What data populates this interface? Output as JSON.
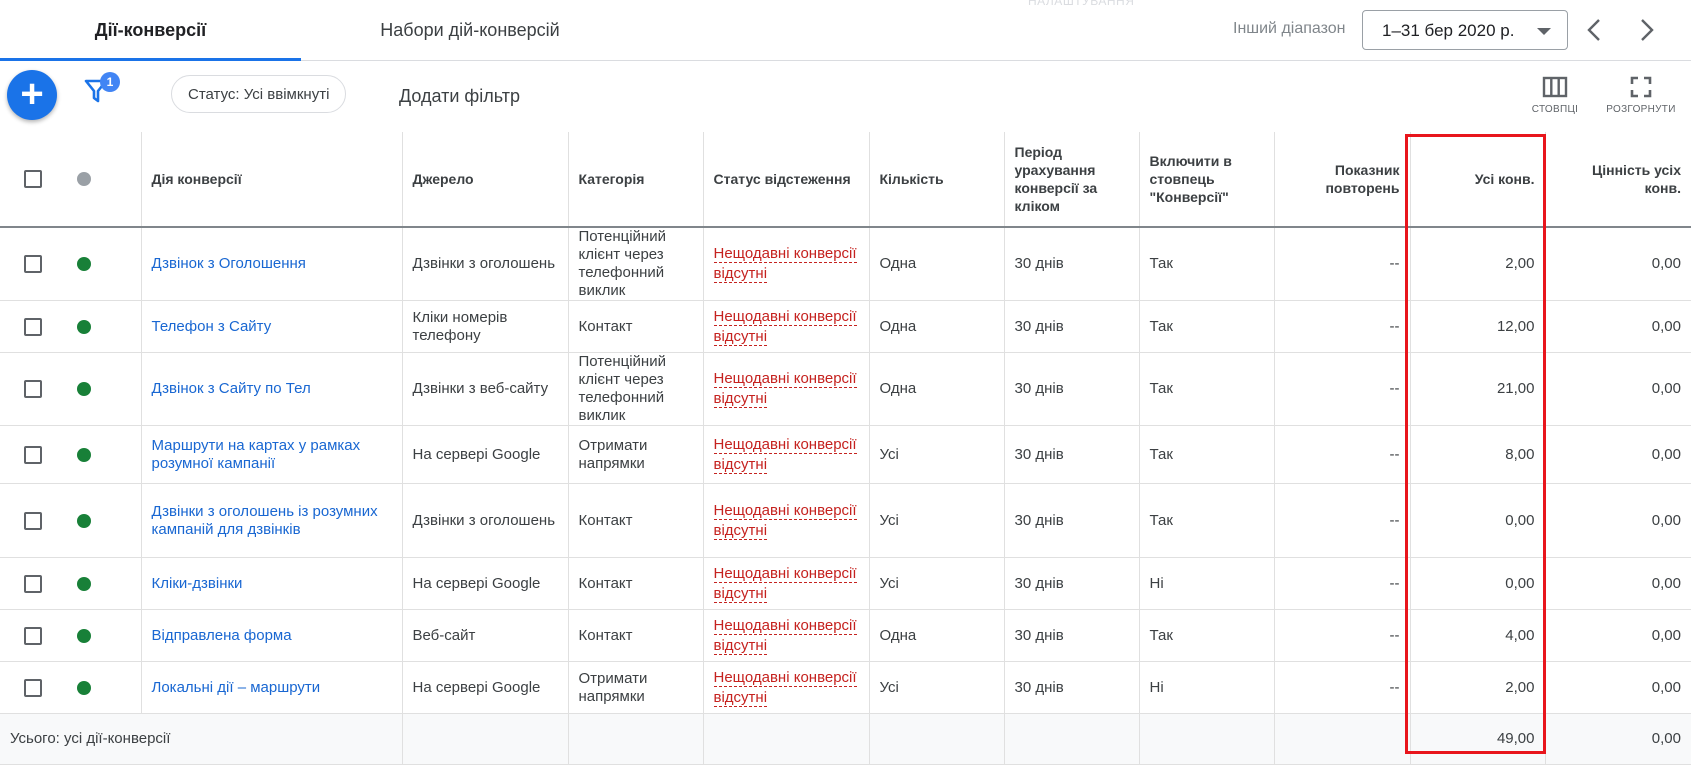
{
  "ghost_text": "НАЛАШТУВАННЯ",
  "tabs": [
    {
      "label": "Дії-конверсії",
      "active": true
    },
    {
      "label": "Набори дій-конверсій",
      "active": false
    }
  ],
  "date_range": {
    "label": "Інший діапазон",
    "value": "1–31 бер 2020 р."
  },
  "toolbar": {
    "filter_badge": "1",
    "status_chip": "Статус: Усі ввімкнуті",
    "add_filter": "Додати фільтр",
    "columns_label": "СТОВПЦІ",
    "expand_label": "РОЗГОРНУТИ"
  },
  "colors": {
    "accent": "#1a73e8",
    "link": "#1967d2",
    "status_red": "#c5221f",
    "enabled_green": "#188038",
    "highlight": "#e8151c"
  },
  "table": {
    "headers": {
      "action": "Дія конверсії",
      "source": "Джерело",
      "category": "Категорія",
      "tracking": "Статус відстеження",
      "count": "Кількість",
      "window": "Період урахування конверсії за кліком",
      "include": "Включити в стовпець \"Конверсії\"",
      "repeat": "Показник повторень",
      "all_conv": "Усі конв.",
      "all_value": "Цінність усіх конв."
    },
    "rows": [
      {
        "action": "Дзвінок з Оголошення",
        "source": "Дзвінки з оголошень",
        "category": "Потенційний клієнт через телефонний виклик",
        "tracking": "Нещодавні конверсії відсутні",
        "count": "Одна",
        "window": "30 днів",
        "include": "Так",
        "repeat": "--",
        "all_conv": "2,00",
        "all_value": "0,00"
      },
      {
        "action": "Телефон з Сайту",
        "source": "Кліки номерів телефону",
        "category": "Контакт",
        "tracking": "Нещодавні конверсії відсутні",
        "count": "Одна",
        "window": "30 днів",
        "include": "Так",
        "repeat": "--",
        "all_conv": "12,00",
        "all_value": "0,00"
      },
      {
        "action": "Дзвінок з Сайту по Тел",
        "source": "Дзвінки з веб-сайту",
        "category": "Потенційний клієнт через телефонний виклик",
        "tracking": "Нещодавні конверсії відсутні",
        "count": "Одна",
        "window": "30 днів",
        "include": "Так",
        "repeat": "--",
        "all_conv": "21,00",
        "all_value": "0,00"
      },
      {
        "action": "Маршрути на картах у рамках розумної кампанії",
        "source": "На сервері Google",
        "category": "Отримати напрямки",
        "tracking": "Нещодавні конверсії відсутні",
        "count": "Усі",
        "window": "30 днів",
        "include": "Так",
        "repeat": "--",
        "all_conv": "8,00",
        "all_value": "0,00"
      },
      {
        "action": "Дзвінки з оголошень із розумних кампаній для дзвінків",
        "source": "Дзвінки з оголошень",
        "category": "Контакт",
        "tracking": "Нещодавні конверсії відсутні",
        "count": "Усі",
        "window": "30 днів",
        "include": "Так",
        "repeat": "--",
        "all_conv": "0,00",
        "all_value": "0,00"
      },
      {
        "action": "Кліки-дзвінки",
        "source": "На сервері Google",
        "category": "Контакт",
        "tracking": "Нещодавні конверсії відсутні",
        "count": "Усі",
        "window": "30 днів",
        "include": "Ні",
        "repeat": "--",
        "all_conv": "0,00",
        "all_value": "0,00"
      },
      {
        "action": "Відправлена форма",
        "source": "Веб-сайт",
        "category": "Контакт",
        "tracking": "Нещодавні конверсії відсутні",
        "count": "Одна",
        "window": "30 днів",
        "include": "Так",
        "repeat": "--",
        "all_conv": "4,00",
        "all_value": "0,00"
      },
      {
        "action": "Локальні дії – маршрути",
        "source": "На сервері Google",
        "category": "Отримати напрямки",
        "tracking": "Нещодавні конверсії відсутні",
        "count": "Усі",
        "window": "30 днів",
        "include": "Ні",
        "repeat": "--",
        "all_conv": "2,00",
        "all_value": "0,00"
      }
    ],
    "total": {
      "label": "Усього: усі дії-конверсії",
      "all_conv": "49,00",
      "all_value": "0,00"
    }
  }
}
